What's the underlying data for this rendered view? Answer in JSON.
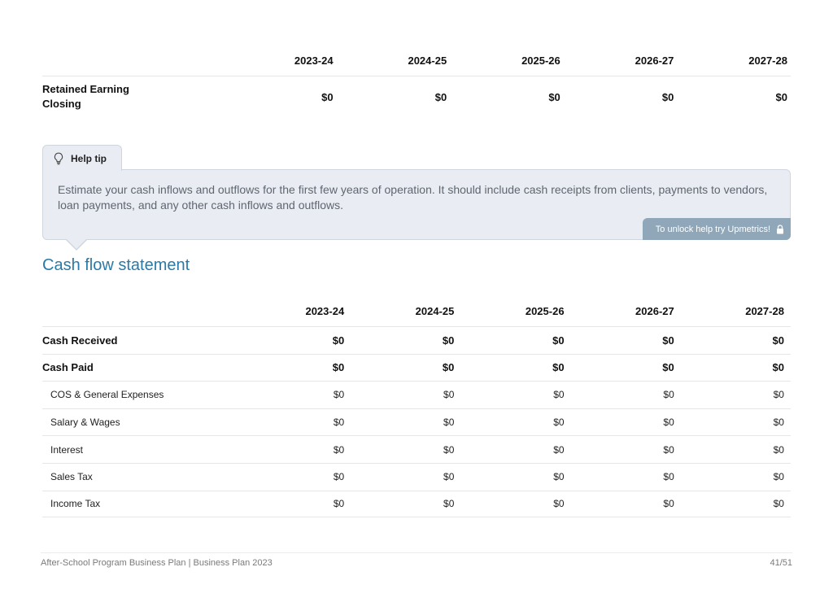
{
  "retained": {
    "years": [
      "2023-24",
      "2024-25",
      "2025-26",
      "2026-27",
      "2027-28"
    ],
    "label_line1": "Retained Earning",
    "label_line2": "Closing",
    "values": [
      "$0",
      "$0",
      "$0",
      "$0",
      "$0"
    ]
  },
  "help_tip": {
    "tab_label": "Help tip",
    "icon": "lightbulb-icon",
    "text": "Estimate your cash inflows and outflows for the first few years of operation. It should include cash receipts from clients, payments to vendors, loan payments, and any other cash inflows and outflows.",
    "unlock_text": "To unlock help try Upmetrics!",
    "unlock_icon": "lock-icon",
    "bg_color": "#e9edf3",
    "badge_color": "#8fa7b8"
  },
  "cash_flow": {
    "title": "Cash flow statement",
    "title_color": "#2a7aa8",
    "years": [
      "2023-24",
      "2024-25",
      "2025-26",
      "2026-27",
      "2027-28"
    ],
    "rows": [
      {
        "label": "Cash Received",
        "values": [
          "$0",
          "$0",
          "$0",
          "$0",
          "$0"
        ]
      },
      {
        "label": "Cash Paid",
        "values": [
          "$0",
          "$0",
          "$0",
          "$0",
          "$0"
        ]
      },
      {
        "label": "COS & General Expenses",
        "values": [
          "$0",
          "$0",
          "$0",
          "$0",
          "$0"
        ]
      },
      {
        "label": "Salary & Wages",
        "values": [
          "$0",
          "$0",
          "$0",
          "$0",
          "$0"
        ]
      },
      {
        "label": "Interest",
        "values": [
          "$0",
          "$0",
          "$0",
          "$0",
          "$0"
        ]
      },
      {
        "label": "Sales Tax",
        "values": [
          "$0",
          "$0",
          "$0",
          "$0",
          "$0"
        ]
      },
      {
        "label": "Income Tax",
        "values": [
          "$0",
          "$0",
          "$0",
          "$0",
          "$0"
        ]
      }
    ]
  },
  "footer": {
    "left": "After-School Program Business Plan | Business Plan 2023",
    "page": "41/51"
  }
}
